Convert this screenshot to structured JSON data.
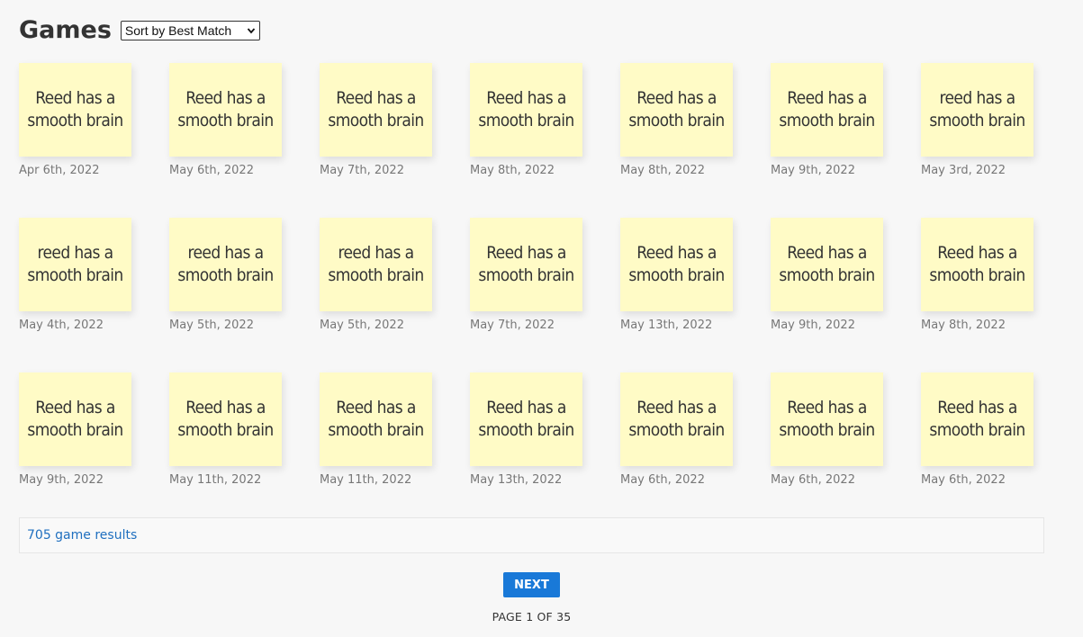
{
  "header": {
    "title": "Games",
    "sort_value": "Sort by Best Match"
  },
  "cards": [
    {
      "line1": "Reed has a",
      "line2": "smooth brain",
      "date": "Apr 6th, 2022"
    },
    {
      "line1": "Reed has a",
      "line2": "smooth brain",
      "date": "May 6th, 2022"
    },
    {
      "line1": "Reed has a",
      "line2": "smooth brain",
      "date": "May 7th, 2022"
    },
    {
      "line1": "Reed has a",
      "line2": "smooth brain",
      "date": "May 8th, 2022"
    },
    {
      "line1": "Reed has a",
      "line2": "smooth brain",
      "date": "May 8th, 2022"
    },
    {
      "line1": "Reed has a",
      "line2": "smooth brain",
      "date": "May 9th, 2022"
    },
    {
      "line1": "reed has a",
      "line2": "smooth brain",
      "date": "May 3rd, 2022"
    },
    {
      "line1": "reed has a",
      "line2": "smooth brain",
      "date": "May 4th, 2022"
    },
    {
      "line1": "reed has a",
      "line2": "smooth brain",
      "date": "May 5th, 2022"
    },
    {
      "line1": "reed has a",
      "line2": "smooth brain",
      "date": "May 5th, 2022"
    },
    {
      "line1": "Reed has a",
      "line2": "smooth brain",
      "date": "May 7th, 2022"
    },
    {
      "line1": "Reed has a",
      "line2": "smooth brain",
      "date": "May 13th, 2022"
    },
    {
      "line1": "Reed has a",
      "line2": "smooth brain",
      "date": "May 9th, 2022"
    },
    {
      "line1": "Reed has a",
      "line2": "smooth brain",
      "date": "May 8th, 2022"
    },
    {
      "line1": "Reed has a",
      "line2": "smooth brain",
      "date": "May 9th, 2022"
    },
    {
      "line1": "Reed has a",
      "line2": "smooth brain",
      "date": "May 11th, 2022"
    },
    {
      "line1": "Reed has a",
      "line2": "smooth brain",
      "date": "May 11th, 2022"
    },
    {
      "line1": "Reed has a",
      "line2": "smooth brain",
      "date": "May 13th, 2022"
    },
    {
      "line1": "Reed has a",
      "line2": "smooth brain",
      "date": "May 6th, 2022"
    },
    {
      "line1": "Reed has a",
      "line2": "smooth brain",
      "date": "May 6th, 2022"
    },
    {
      "line1": "Reed has a",
      "line2": "smooth brain",
      "date": "May 6th, 2022"
    }
  ],
  "results": {
    "count_text": "705 game results"
  },
  "pagination": {
    "next_label": "NEXT",
    "page_text": "PAGE 1 OF 35"
  },
  "colors": {
    "note_background": "#fffbc6",
    "accent": "#1979d8",
    "link": "#1f6fbf"
  },
  "icons": {
    "sort_chevron": "chevron-down-icon"
  }
}
